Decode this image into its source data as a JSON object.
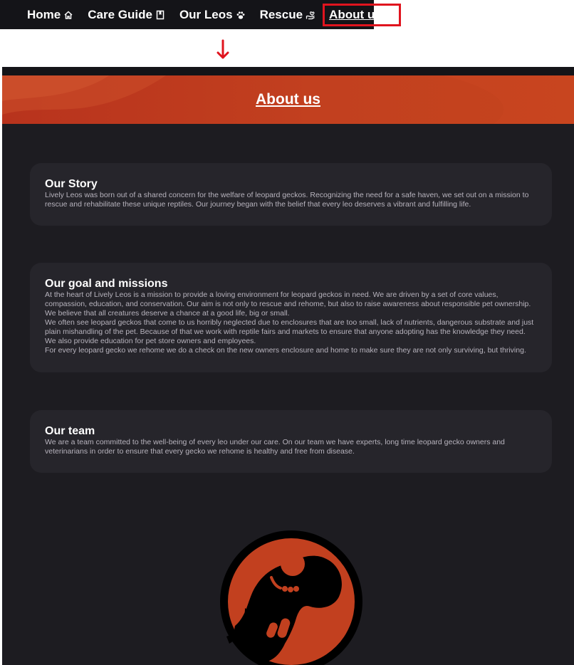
{
  "nav": {
    "items": [
      {
        "label": "Home",
        "icon": "home-icon"
      },
      {
        "label": "Care Guide",
        "icon": "book-icon"
      },
      {
        "label": "Our Leos",
        "icon": "paw-icon"
      },
      {
        "label": "Rescue",
        "icon": "hand-heart-icon"
      },
      {
        "label": "About us",
        "icon": "info-icon",
        "active": true
      }
    ]
  },
  "colors": {
    "accent": "#c2401f",
    "background": "#1d1c21",
    "card": "#26252b",
    "highlight": "#e0141e"
  },
  "banner": {
    "title": "About us"
  },
  "sections": [
    {
      "title": "Our Story",
      "paragraphs": [
        "Lively Leos was born out of a shared concern for the welfare of leopard geckos. Recognizing the need for a safe haven, we set out on a mission to rescue and rehabilitate these unique reptiles. Our journey began with the belief that every leo deserves a vibrant and fulfilling life."
      ]
    },
    {
      "title": "Our goal and missions",
      "paragraphs": [
        "At the heart of Lively Leos is a mission to provide a loving environment for leopard geckos in need. We are driven by a set of core values, compassion, education, and conservation. Our aim is not only to rescue and rehome, but also to raise awareness about responsible pet ownership. We believe that all creatures deserve a chance at a good life, big or small.",
        "We often see leopard geckos that come to us horribly neglected due to enclosures that are too small, lack of nutrients, dangerous substrate and just plain mishandling of the pet. Because of that we work with reptile fairs and markets to ensure that anyone adopting has the knowledge they need. We also provide education for pet store owners and employees.",
        "For every leopard gecko we rehome we do a check on the new owners enclosure and home to make sure they are not only surviving, but thriving."
      ]
    },
    {
      "title": "Our team",
      "paragraphs": [
        "We are a team committed to the well-being of every leo under our care. On our team we have experts, long time leopard gecko owners and veterinarians in order to ensure that every gecko we rehome is healthy and free from disease."
      ]
    }
  ]
}
